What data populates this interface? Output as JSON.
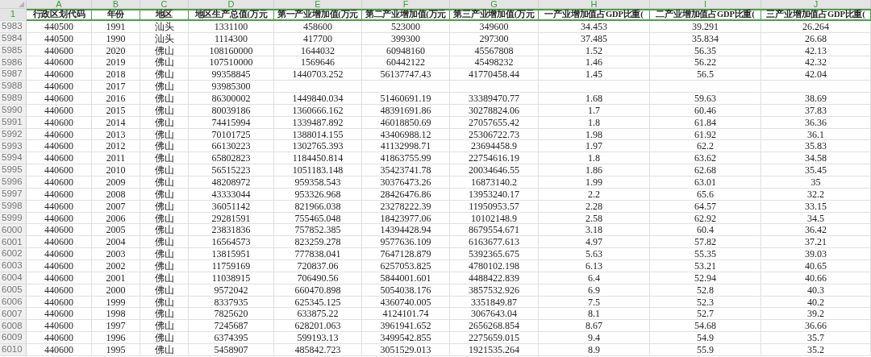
{
  "sheet": {
    "column_letters": [
      "A",
      "B",
      "C",
      "D",
      "E",
      "F",
      "G",
      "H",
      "I",
      "J"
    ],
    "header_row": {
      "row_number": "1",
      "selected": true,
      "cells": [
        "行政区划代码",
        "年份",
        "地区",
        "地区生产总值(万元",
        "第一产业增加值(万元",
        "第二产业增加值(万元",
        "第三产业增加值(万元",
        "一产业增加值占GDP比重(",
        "二产业增加值占GDP比重(",
        "三产业增加值占GDP比重("
      ]
    },
    "rows": [
      {
        "row_number": "5983",
        "cells": [
          "440500",
          "1991",
          "汕头",
          "1331100",
          "458600",
          "523000",
          "349600",
          "34.453",
          "39.291",
          "26.264"
        ]
      },
      {
        "row_number": "5984",
        "cells": [
          "440500",
          "1990",
          "汕头",
          "1114300",
          "417700",
          "399300",
          "297300",
          "37.485",
          "35.834",
          "26.68"
        ]
      },
      {
        "row_number": "5985",
        "cells": [
          "440600",
          "2020",
          "佛山",
          "108160000",
          "1644032",
          "60948160",
          "45567808",
          "1.52",
          "56.35",
          "42.13"
        ]
      },
      {
        "row_number": "5986",
        "cells": [
          "440600",
          "2019",
          "佛山",
          "107510000",
          "1569646",
          "60442122",
          "45498232",
          "1.46",
          "56.22",
          "42.32"
        ]
      },
      {
        "row_number": "5987",
        "cells": [
          "440600",
          "2018",
          "佛山",
          "99358845",
          "1440703.252",
          "56137747.43",
          "41770458.44",
          "1.45",
          "56.5",
          "42.04"
        ]
      },
      {
        "row_number": "5988",
        "cells": [
          "440600",
          "2017",
          "佛山",
          "93985300",
          null,
          null,
          null,
          null,
          null,
          null
        ]
      },
      {
        "row_number": "5989",
        "cells": [
          "440600",
          "2016",
          "佛山",
          "86300002",
          "1449840.034",
          "51460691.19",
          "33389470.77",
          "1.68",
          "59.63",
          "38.69"
        ]
      },
      {
        "row_number": "5990",
        "cells": [
          "440600",
          "2015",
          "佛山",
          "80039186",
          "1360666.162",
          "48391691.86",
          "30278824.06",
          "1.7",
          "60.46",
          "37.83"
        ]
      },
      {
        "row_number": "5991",
        "cells": [
          "440600",
          "2014",
          "佛山",
          "74415994",
          "1339487.892",
          "46018850.69",
          "27057655.42",
          "1.8",
          "61.84",
          "36.36"
        ]
      },
      {
        "row_number": "5992",
        "cells": [
          "440600",
          "2013",
          "佛山",
          "70101725",
          "1388014.155",
          "43406988.12",
          "25306722.73",
          "1.98",
          "61.92",
          "36.1"
        ]
      },
      {
        "row_number": "5993",
        "cells": [
          "440600",
          "2012",
          "佛山",
          "66130223",
          "1302765.393",
          "41132998.71",
          "23694458.9",
          "1.97",
          "62.2",
          "35.83"
        ]
      },
      {
        "row_number": "5994",
        "cells": [
          "440600",
          "2011",
          "佛山",
          "65802823",
          "1184450.814",
          "41863755.99",
          "22754616.19",
          "1.8",
          "63.62",
          "34.58"
        ]
      },
      {
        "row_number": "5995",
        "cells": [
          "440600",
          "2010",
          "佛山",
          "56515223",
          "1051183.148",
          "35423741.78",
          "20034646.55",
          "1.86",
          "62.68",
          "35.45"
        ]
      },
      {
        "row_number": "5996",
        "cells": [
          "440600",
          "2009",
          "佛山",
          "48208972",
          "959358.543",
          "30376473.26",
          "16873140.2",
          "1.99",
          "63.01",
          "35"
        ]
      },
      {
        "row_number": "5997",
        "cells": [
          "440600",
          "2008",
          "佛山",
          "43333044",
          "953326.968",
          "28426476.86",
          "13953240.17",
          "2.2",
          "65.6",
          "32.2"
        ]
      },
      {
        "row_number": "5998",
        "cells": [
          "440600",
          "2007",
          "佛山",
          "36051142",
          "821966.038",
          "23278222.39",
          "11950953.57",
          "2.28",
          "64.57",
          "33.15"
        ]
      },
      {
        "row_number": "5999",
        "cells": [
          "440600",
          "2006",
          "佛山",
          "29281591",
          "755465.048",
          "18423977.06",
          "10102148.9",
          "2.58",
          "62.92",
          "34.5"
        ]
      },
      {
        "row_number": "6000",
        "cells": [
          "440600",
          "2005",
          "佛山",
          "23831836",
          "757852.385",
          "14394428.94",
          "8679554.671",
          "3.18",
          "60.4",
          "36.42"
        ]
      },
      {
        "row_number": "6001",
        "cells": [
          "440600",
          "2004",
          "佛山",
          "16564573",
          "823259.278",
          "9577636.109",
          "6163677.613",
          "4.97",
          "57.82",
          "37.21"
        ]
      },
      {
        "row_number": "6002",
        "cells": [
          "440600",
          "2003",
          "佛山",
          "13815951",
          "777838.041",
          "7647128.879",
          "5392365.675",
          "5.63",
          "55.35",
          "39.03"
        ]
      },
      {
        "row_number": "6003",
        "cells": [
          "440600",
          "2002",
          "佛山",
          "11759169",
          "720837.06",
          "6257053.825",
          "4780102.198",
          "6.13",
          "53.21",
          "40.65"
        ]
      },
      {
        "row_number": "6004",
        "cells": [
          "440600",
          "2001",
          "佛山",
          "11038915",
          "706490.56",
          "5844001.601",
          "4488422.839",
          "6.4",
          "52.94",
          "40.66"
        ]
      },
      {
        "row_number": "6005",
        "cells": [
          "440600",
          "2000",
          "佛山",
          "9572042",
          "660470.898",
          "5054038.176",
          "3857532.926",
          "6.9",
          "52.8",
          "40.3"
        ]
      },
      {
        "row_number": "6006",
        "cells": [
          "440600",
          "1999",
          "佛山",
          "8337935",
          "625345.125",
          "4360740.005",
          "3351849.87",
          "7.5",
          "52.3",
          "40.2"
        ]
      },
      {
        "row_number": "6007",
        "cells": [
          "440600",
          "1998",
          "佛山",
          "7825620",
          "633875.22",
          "4124101.74",
          "3067643.04",
          "8.1",
          "52.7",
          "39.2"
        ]
      },
      {
        "row_number": "6008",
        "cells": [
          "440600",
          "1997",
          "佛山",
          "7245687",
          "628201.063",
          "3961941.652",
          "2656268.854",
          "8.67",
          "54.68",
          "36.66"
        ]
      },
      {
        "row_number": "6009",
        "cells": [
          "440600",
          "1996",
          "佛山",
          "6374395",
          "599193.13",
          "3499542.855",
          "2275659.015",
          "9.4",
          "54.9",
          "35.7"
        ]
      },
      {
        "row_number": "6010",
        "cells": [
          "440600",
          "1995",
          "佛山",
          "5458907",
          "485842.723",
          "3051529.013",
          "1921535.264",
          "8.9",
          "55.9",
          "35.2"
        ]
      }
    ]
  }
}
